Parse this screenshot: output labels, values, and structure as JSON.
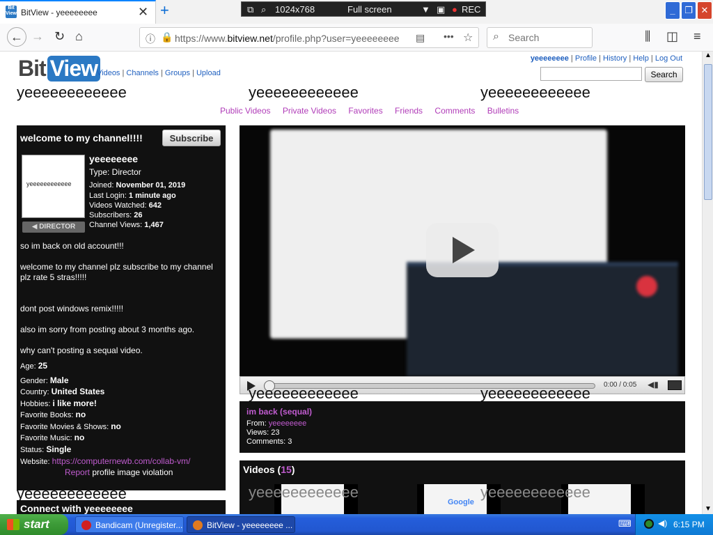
{
  "browser": {
    "tab_title": "BitView - yeeeeeeee",
    "url_prefix": "https://www.",
    "url_domain": "bitview.net",
    "url_path": "/profile.php?user=yeeeeeeee",
    "search_placeholder": "Search"
  },
  "bandicam": {
    "resolution": "1024x768",
    "mode": "Full screen",
    "rec": "REC"
  },
  "site": {
    "logo_bit": "Bit",
    "logo_view": "View",
    "nav": {
      "videos": "Videos",
      "channels": "Channels",
      "groups": "Groups",
      "upload": "Upload"
    },
    "user_nav": {
      "username": "yeeeeeeee",
      "profile": "Profile",
      "history": "History",
      "help": "Help",
      "logout": "Log Out"
    },
    "search_button": "Search"
  },
  "background_text": "yeeeeeeeeeeee",
  "profile_nav": [
    "Public Videos",
    "Private Videos",
    "Favorites",
    "Friends",
    "Comments",
    "Bulletins"
  ],
  "channel": {
    "welcome": "welcome to my channel!!!!",
    "subscribe": "Subscribe",
    "avatar_text": "yeeeeeeeeeeee",
    "badge": "DIRECTOR",
    "name": "yeeeeeeee",
    "type": "Type: Director",
    "joined_label": "Joined:",
    "joined": "November 01, 2019",
    "last_login_label": "Last Login:",
    "last_login": "1 minute ago",
    "videos_watched_label": "Videos Watched:",
    "videos_watched": "642",
    "subscribers_label": "Subscribers:",
    "subscribers": "26",
    "channel_views_label": "Channel Views:",
    "channel_views": "1,467",
    "desc": [
      "so im back on old account!!!",
      "welcome to my channel plz subscribe to my channel plz rate 5 stras!!!!!",
      "dont post windows remix!!!!!",
      "also im sorry from posting about 3 months ago.",
      "why can't posting a sequal video."
    ],
    "fields": [
      {
        "label": "Age:",
        "value": "25"
      },
      {
        "label": "Gender:",
        "value": "Male"
      },
      {
        "label": "Country:",
        "value": "United States"
      },
      {
        "label": "Hobbies:",
        "value": "i like more!"
      },
      {
        "label": "Favorite Books:",
        "value": "no"
      },
      {
        "label": "Favorite Movies & Shows:",
        "value": "no"
      },
      {
        "label": "Favorite Music:",
        "value": "no"
      },
      {
        "label": "Status:",
        "value": "Single"
      }
    ],
    "website_label": "Website:",
    "website": "https://computernewb.com/collab-vm/",
    "report": "Report",
    "report_rest": "profile image violation",
    "connect": "Connect with yeeeeeeee"
  },
  "video": {
    "time": "0:00 / 0:05",
    "title": "im back (sequal)",
    "from_label": "From:",
    "from": "yeeeeeeee",
    "views": "Views: 23",
    "comments": "Comments: 3"
  },
  "videos_panel": {
    "label": "Videos",
    "count": "15",
    "thumb_text": "Google"
  },
  "taskbar": {
    "start": "start",
    "item1": "Bandicam (Unregister...",
    "item2": "BitView - yeeeeeeee ...",
    "clock": "6:15 PM"
  }
}
